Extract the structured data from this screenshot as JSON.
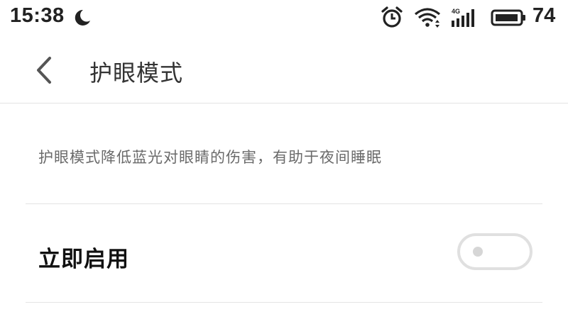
{
  "status_bar": {
    "time": "15:38",
    "icons": [
      "moon-icon",
      "alarm-icon",
      "wifi-icon",
      "signal-icon",
      "battery-icon"
    ],
    "network_label": "4G",
    "battery_level": "74"
  },
  "header": {
    "back_icon": "chevron-left-icon",
    "title": "护眼模式"
  },
  "main": {
    "description": "护眼模式降低蓝光对眼睛的伤害，有助于夜间睡眠",
    "settings": [
      {
        "label": "立即启用",
        "enabled": false
      }
    ]
  },
  "colors": {
    "background": "#ffffff",
    "divider": "#e4e4e4",
    "toggle_off": "#e0e0e0",
    "text_primary": "#111111",
    "text_secondary": "#6a6a6a"
  }
}
